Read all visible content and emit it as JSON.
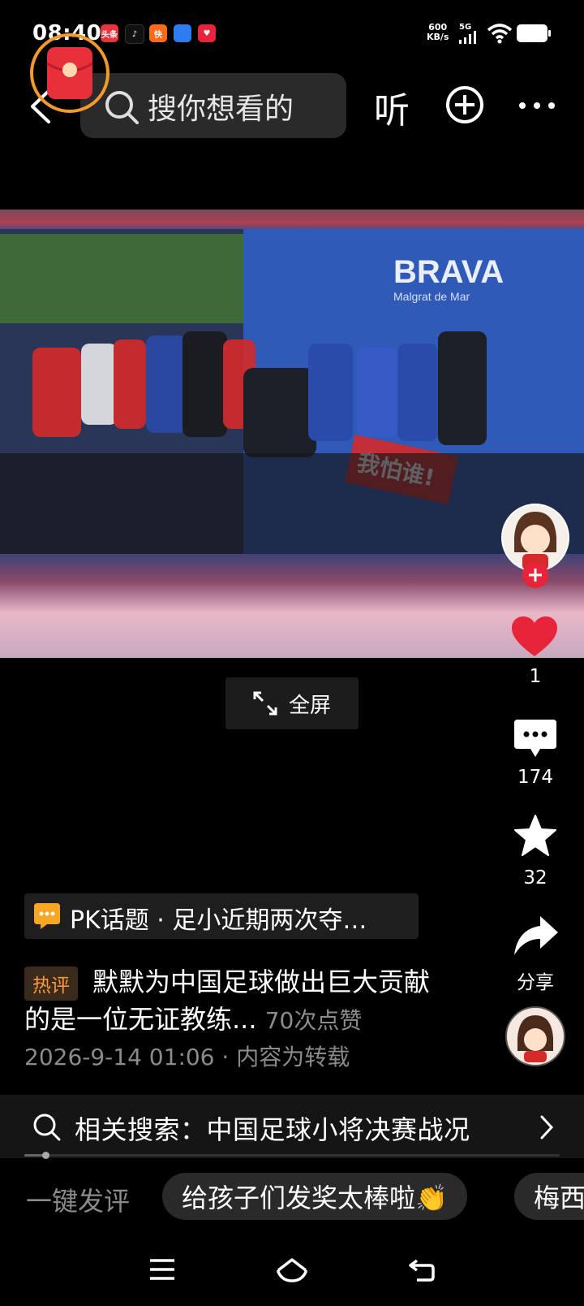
{
  "status_bar": {
    "time": "08:40",
    "notif_apps": [
      {
        "name": "toutiao-app-icon",
        "label": "头条",
        "color": "#e8343a"
      },
      {
        "name": "douyin-app-icon",
        "label": "♪",
        "color": "#111111"
      },
      {
        "name": "kuaishou-app-icon",
        "label": "快",
        "color": "#ff6a1a"
      },
      {
        "name": "blue-app-icon",
        "label": "",
        "color": "#2f7bf0"
      },
      {
        "name": "heart-app-icon",
        "label": "♥",
        "color": "#e8243a"
      }
    ],
    "net_speed_value": "600",
    "net_speed_unit": "KB/s",
    "network": "5G"
  },
  "header": {
    "search_placeholder": "搜你想看的",
    "listen_label": "听"
  },
  "video": {
    "fullscreen_label": "全屏"
  },
  "rail": {
    "like_count": "1",
    "comment_count": "174",
    "favorite_count": "32",
    "share_label": "分享"
  },
  "topic": {
    "text": "PK话题 · 足小近期两次夺…"
  },
  "hot_comment": {
    "badge": "热评",
    "text": "默默为中国足球做出巨大贡献的是一位无证教练...",
    "likes": "70次点赞"
  },
  "meta": {
    "date": "2026-9-14 01:06",
    "separator": "·",
    "source": "内容为转载"
  },
  "related_search": {
    "label": "相关搜索：",
    "query": "中国足球小将决赛战况"
  },
  "progress": {
    "fraction": 0.04
  },
  "quick_comment": {
    "label": "一键发评",
    "chips": [
      "给孩子们发奖太棒啦👏",
      "梅西"
    ]
  },
  "colors": {
    "accent_red": "#e8243a",
    "hot_orange": "#ff9a3c",
    "ring_orange": "#f39a2a"
  }
}
